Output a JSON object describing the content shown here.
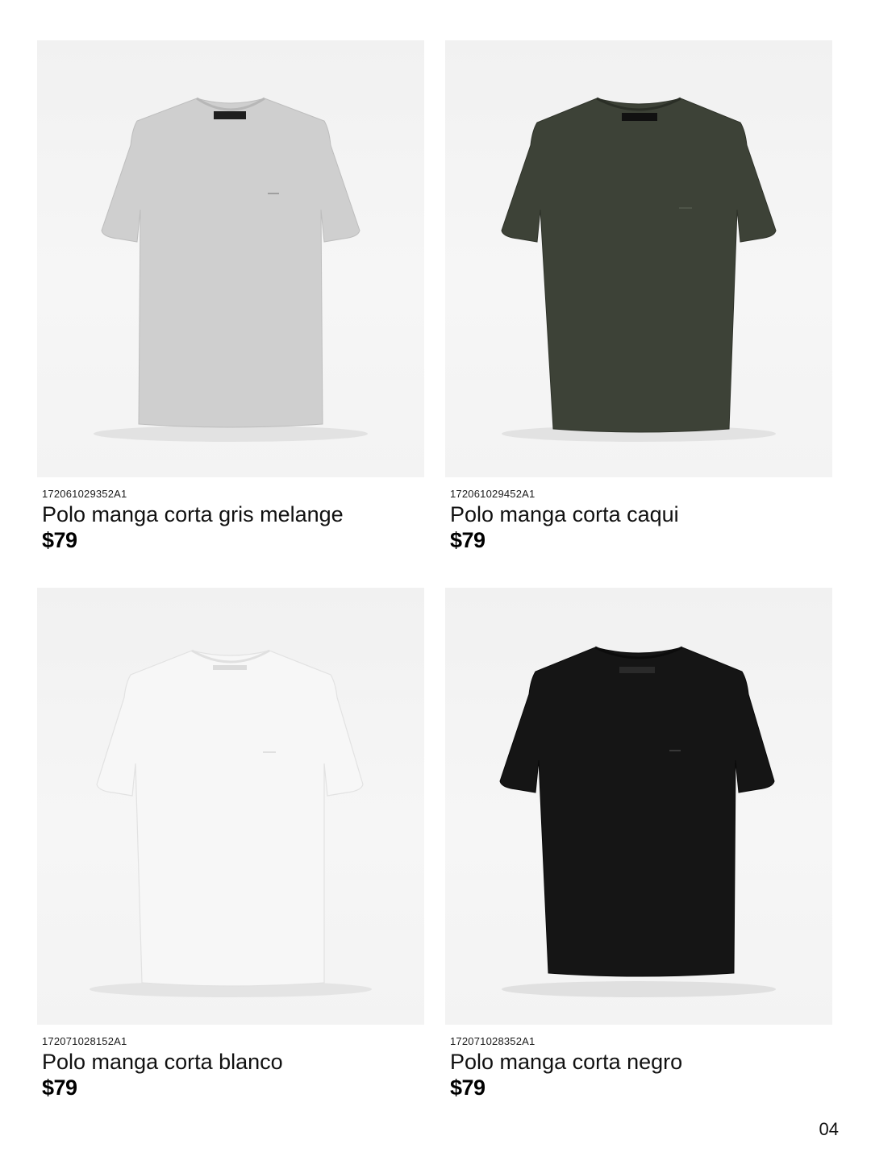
{
  "colors": {
    "gris_melange": "#cfcfcf",
    "caqui": "#3d4237",
    "blanco": "#f7f7f7",
    "negro": "#151515",
    "photo_bg": "#f3f3f3"
  },
  "products": [
    {
      "sku": "172061029352A1",
      "name": "Polo manga corta gris melange",
      "price": "$79",
      "image": "tshirt-gris-melange"
    },
    {
      "sku": "172061029452A1",
      "name": "Polo manga corta caqui",
      "price": "$79",
      "image": "tshirt-caqui"
    },
    {
      "sku": "172071028152A1",
      "name": "Polo manga corta blanco",
      "price": "$79",
      "image": "tshirt-blanco"
    },
    {
      "sku": "172071028352A1",
      "name": "Polo manga corta negro",
      "price": "$79",
      "image": "tshirt-negro"
    }
  ],
  "page_number": "04"
}
